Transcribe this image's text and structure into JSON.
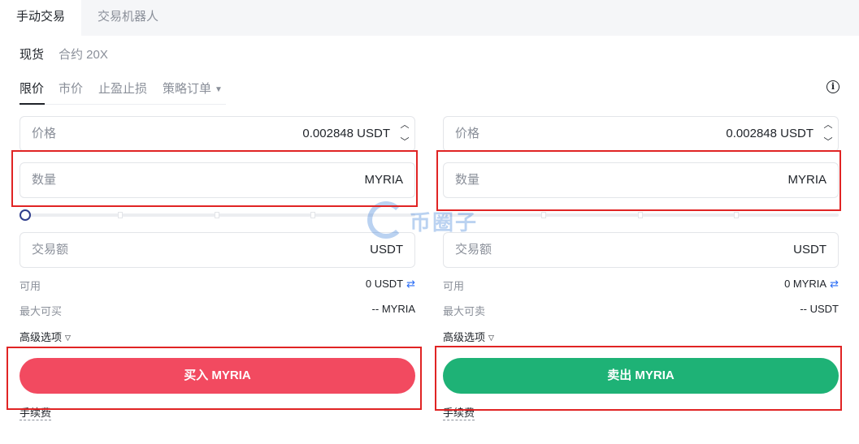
{
  "top_tabs": [
    "手动交易",
    "交易机器人"
  ],
  "account_tabs": [
    "现货",
    "合约 20X"
  ],
  "order_tabs": [
    "限价",
    "市价",
    "止盈止损",
    "策略订单"
  ],
  "buy": {
    "price_label": "价格",
    "price_value": "0.002848 USDT",
    "qty_label": "数量",
    "qty_unit": "MYRIA",
    "amount_label": "交易额",
    "amount_unit": "USDT",
    "available_label": "可用",
    "available_value": "0 USDT",
    "max_label": "最大可买",
    "max_value": "-- MYRIA",
    "advanced_label": "高级选项",
    "action_label": "买入 MYRIA",
    "fee_label": "手续费"
  },
  "sell": {
    "price_label": "价格",
    "price_value": "0.002848 USDT",
    "qty_label": "数量",
    "qty_unit": "MYRIA",
    "amount_label": "交易额",
    "amount_unit": "USDT",
    "available_label": "可用",
    "available_value": "0 MYRIA",
    "max_label": "最大可卖",
    "max_value": "-- USDT",
    "advanced_label": "高级选项",
    "action_label": "卖出 MYRIA",
    "fee_label": "手续费"
  },
  "slider_percent": 0,
  "icons": {
    "info": "info-icon",
    "swap": "swap-icon",
    "chevron": "chevron-down-icon",
    "stepper_up": "chevron-up-icon",
    "stepper_down": "chevron-down-icon"
  },
  "watermark_text": "币圈子",
  "colors": {
    "buy": "#f24a60",
    "sell": "#1eb276",
    "highlight": "#e02424",
    "link": "#2a6cf5"
  }
}
